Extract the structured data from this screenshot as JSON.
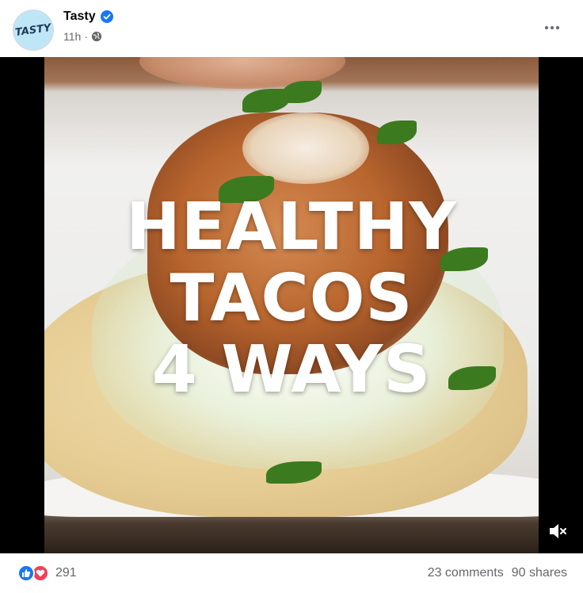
{
  "post": {
    "page_name": "Tasty",
    "avatar_text": "TASTY",
    "timestamp": "11h",
    "separator": "·",
    "audience_icon": "globe-icon",
    "verified_icon": "verified-badge-icon",
    "more_icon": "more-options-icon"
  },
  "video": {
    "overlay_lines": [
      "HEALTHY",
      "TACOS",
      "4 WAYS"
    ],
    "mute_icon": "muted-speaker-icon"
  },
  "engagement": {
    "reaction_icons": [
      "like-icon",
      "love-icon"
    ],
    "reaction_count": "291",
    "comments": "23 comments",
    "shares": "90 shares"
  },
  "colors": {
    "verified": "#1877f2",
    "like": "#1877f2",
    "love": "#f33e58",
    "secondary_text": "#65676b"
  }
}
